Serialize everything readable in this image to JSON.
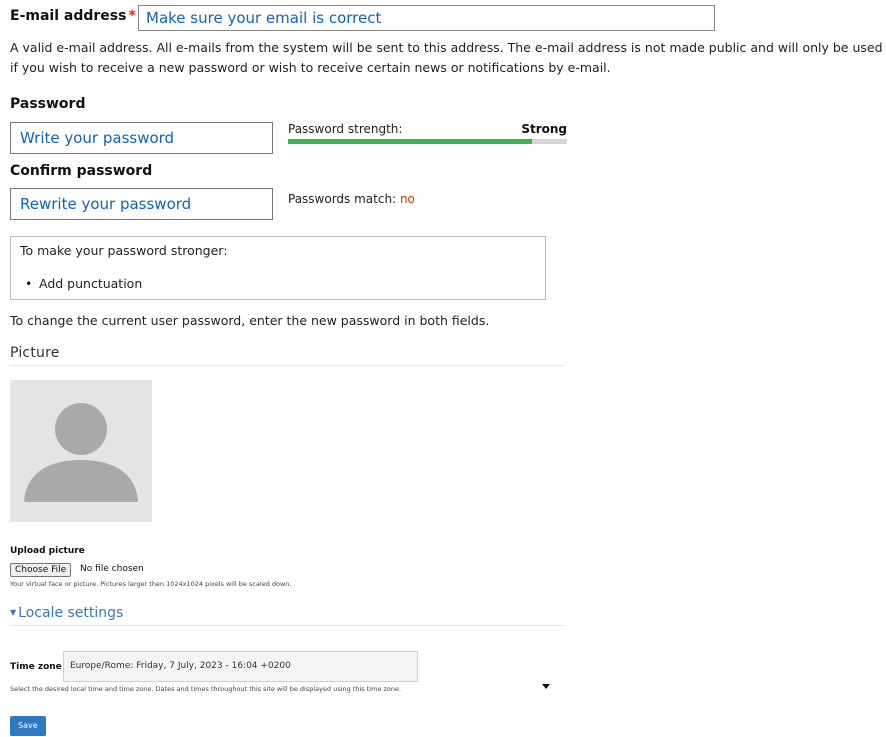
{
  "email": {
    "label": "E-mail address",
    "required_mark": "*",
    "value": "Make sure your email is correct",
    "description": "A valid e-mail address. All e-mails from the system will be sent to this address. The e-mail address is not made public and will only be used if you wish to receive a new password or wish to receive certain news or notifications by e-mail."
  },
  "password": {
    "label": "Password",
    "value": "Write your password",
    "strength_label": "Password strength:",
    "strength_value": "Strong",
    "strength_fraction": 0.875,
    "strength_color": "#3cb550"
  },
  "confirm": {
    "label": "Confirm password",
    "value": "Rewrite your password",
    "match_label": "Passwords match:",
    "match_value": "no"
  },
  "tips": {
    "title": "To make your password stronger:",
    "items": [
      "Add punctuation"
    ]
  },
  "change_note": "To change the current user password, enter the new password in both fields.",
  "picture": {
    "title": "Picture",
    "avatar_icon": "user-silhouette-icon",
    "upload_label": "Upload picture",
    "choose_button": "Choose File",
    "no_file": "No file chosen",
    "description": "Your virtual face or picture. Pictures larger then 1024x1024 pixels will be scaled down."
  },
  "locale": {
    "title": "Locale settings",
    "timezone_label": "Time zone",
    "timezone_value": "Europe/Rome: Friday, 7 July, 2023 - 16:04 +0200",
    "timezone_description": "Select the desired local time and time zone. Dates and times throughout this site will be displayed using this time zone."
  },
  "actions": {
    "save_label": "Save"
  },
  "colors": {
    "accent": "#0f63b8",
    "link": "#3a78b5",
    "button": "#2f78c4",
    "required": "#e22222",
    "mismatch": "#d23a00"
  }
}
